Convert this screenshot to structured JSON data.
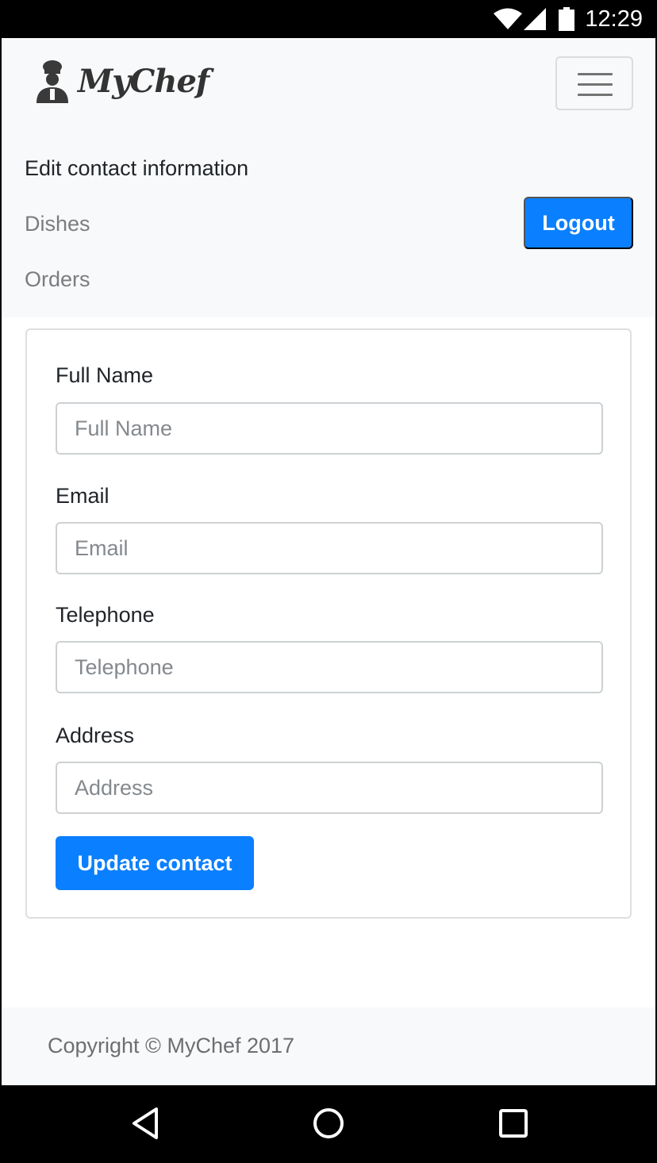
{
  "status_bar": {
    "time": "12:29",
    "icons": [
      "wifi-icon",
      "signal-icon",
      "battery-icon"
    ]
  },
  "navbar": {
    "brand": "MyChef",
    "logo_icon": "chef-icon",
    "menu_icon": "hamburger-icon",
    "items": [
      {
        "label": "Edit contact information",
        "active": true
      },
      {
        "label": "Dishes",
        "active": false
      },
      {
        "label": "Orders",
        "active": false
      }
    ],
    "logout_label": "Logout"
  },
  "form": {
    "fields": [
      {
        "label": "Full Name",
        "placeholder": "Full Name",
        "value": ""
      },
      {
        "label": "Email",
        "placeholder": "Email",
        "value": ""
      },
      {
        "label": "Telephone",
        "placeholder": "Telephone",
        "value": ""
      },
      {
        "label": "Address",
        "placeholder": "Address",
        "value": ""
      }
    ],
    "submit_label": "Update contact"
  },
  "footer": {
    "text": "Copyright © MyChef 2017"
  },
  "system_nav": {
    "icons": [
      "back-icon",
      "home-icon",
      "recents-icon"
    ]
  },
  "colors": {
    "primary": "#0a7fff",
    "navbar_bg": "#f8f9fa",
    "muted_text": "#7a7d80"
  }
}
